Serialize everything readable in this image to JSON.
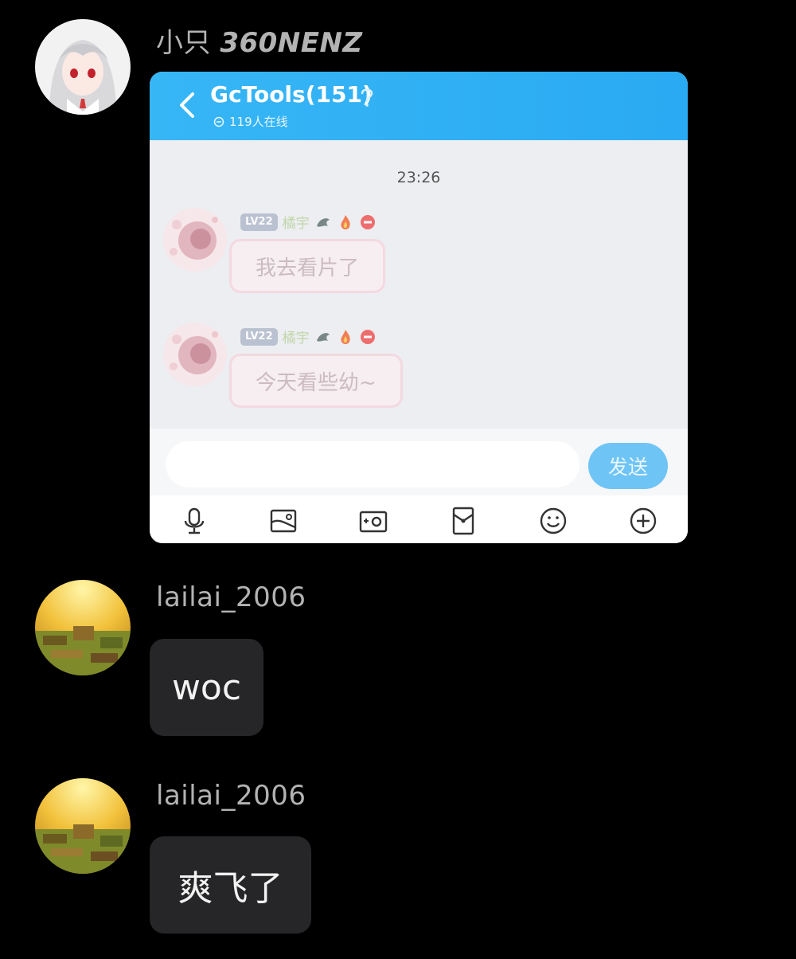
{
  "messages": [
    {
      "username_prefix": "小只",
      "username_styled": "360NENZ",
      "avatar_icon": "anime-girl-avatar-icon",
      "attachment": {
        "type": "screenshot",
        "group_title": "GcTools(151)",
        "online_text": "119人在线",
        "timestamp": "23:26",
        "chat": [
          {
            "level": "LV22",
            "nickname": "橘宇",
            "text": "我去看片了"
          },
          {
            "level": "LV22",
            "nickname": "橘宇",
            "text": "今天看些幼~"
          }
        ],
        "send_label": "发送",
        "toolbar_icons": [
          "microphone-icon",
          "image-icon",
          "camera-icon",
          "red-packet-icon",
          "emoji-icon",
          "plus-icon"
        ]
      }
    },
    {
      "username": "lailai_2006",
      "avatar_icon": "minecraft-village-avatar-icon",
      "text": "woc"
    },
    {
      "username": "lailai_2006",
      "avatar_icon": "minecraft-village-avatar-icon",
      "text": "爽飞了"
    }
  ],
  "colors": {
    "background": "#000000",
    "bubble": "#262628",
    "username": "#b3b3b3",
    "header_blue": "#2aaaf2",
    "send_button": "#6ec4f5"
  }
}
